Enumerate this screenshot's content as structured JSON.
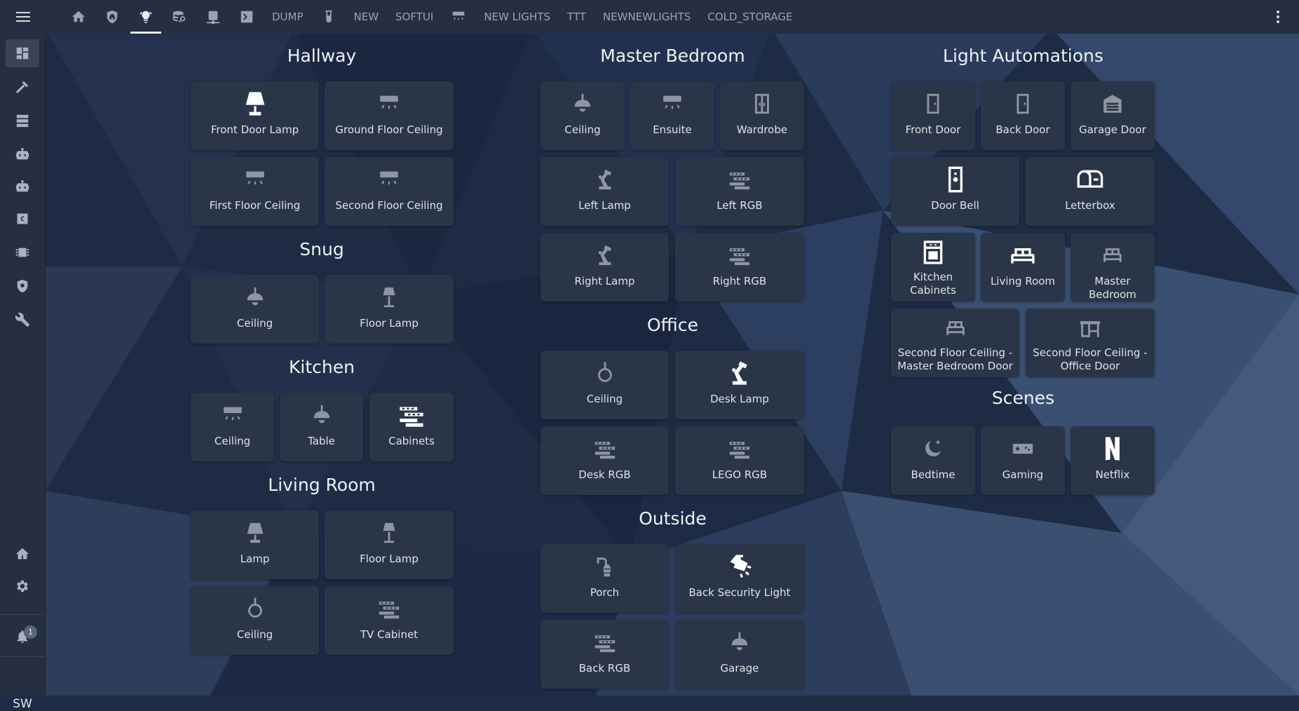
{
  "header": {
    "tabs": [
      {
        "type": "icon",
        "icon": "home-icon",
        "label": ""
      },
      {
        "type": "icon",
        "icon": "shield-home-icon",
        "label": ""
      },
      {
        "type": "icon",
        "icon": "lightbulb-group-icon",
        "label": "",
        "active": true
      },
      {
        "type": "icon",
        "icon": "database-search-icon",
        "label": ""
      },
      {
        "type": "icon",
        "icon": "network-icon",
        "label": ""
      },
      {
        "type": "icon",
        "icon": "console-icon",
        "label": ""
      },
      {
        "type": "text",
        "label": "DUMP"
      },
      {
        "type": "icon",
        "icon": "test-tube-icon",
        "label": ""
      },
      {
        "type": "text",
        "label": "NEW"
      },
      {
        "type": "text",
        "label": "SOFTUI"
      },
      {
        "type": "icon",
        "icon": "ceiling-light-icon",
        "label": ""
      },
      {
        "type": "text",
        "label": "NEW LIGHTS"
      },
      {
        "type": "text",
        "label": "TTT"
      },
      {
        "type": "text",
        "label": "NEWNEWLIGHTS"
      },
      {
        "type": "text",
        "label": "COLD_STORAGE"
      }
    ]
  },
  "sidebar": {
    "user_initials": "SW",
    "notification_count": "1"
  },
  "sections": {
    "hallway": {
      "title": "Hallway",
      "cards": [
        {
          "label": "Front Door Lamp",
          "icon": "lamp-icon",
          "bright": true
        },
        {
          "label": "Ground Floor Ceiling",
          "icon": "ceiling-light-icon"
        },
        {
          "label": "First Floor Ceiling",
          "icon": "ceiling-light-icon"
        },
        {
          "label": "Second Floor Ceiling",
          "icon": "ceiling-light-icon"
        }
      ]
    },
    "snug": {
      "title": "Snug",
      "cards": [
        {
          "label": "Ceiling",
          "icon": "pendant-light-icon"
        },
        {
          "label": "Floor Lamp",
          "icon": "floor-lamp-icon"
        }
      ]
    },
    "kitchen": {
      "title": "Kitchen",
      "cards": [
        {
          "label": "Ceiling",
          "icon": "ceiling-light-icon"
        },
        {
          "label": "Table",
          "icon": "pendant-light-icon"
        },
        {
          "label": "Cabinets",
          "icon": "led-strip-icon",
          "bright": true
        }
      ]
    },
    "living_room": {
      "title": "Living Room",
      "cards": [
        {
          "label": "Lamp",
          "icon": "lamp-icon"
        },
        {
          "label": "Floor Lamp",
          "icon": "floor-lamp-icon"
        },
        {
          "label": "Ceiling",
          "icon": "ceiling-round-icon"
        },
        {
          "label": "TV Cabinet",
          "icon": "led-strip-icon"
        }
      ]
    },
    "master_bedroom": {
      "title": "Master Bedroom",
      "cards": [
        {
          "label": "Ceiling",
          "icon": "pendant-light-icon"
        },
        {
          "label": "Ensuite",
          "icon": "ceiling-light-icon"
        },
        {
          "label": "Wardrobe",
          "icon": "wardrobe-icon"
        },
        {
          "label": "Left Lamp",
          "icon": "desk-lamp-icon"
        },
        {
          "label": "Left RGB",
          "icon": "led-strip-icon"
        },
        {
          "label": "Right Lamp",
          "icon": "desk-lamp-icon"
        },
        {
          "label": "Right RGB",
          "icon": "led-strip-icon"
        }
      ]
    },
    "office": {
      "title": "Office",
      "cards": [
        {
          "label": "Ceiling",
          "icon": "ceiling-round-icon"
        },
        {
          "label": "Desk Lamp",
          "icon": "desk-lamp-icon",
          "bright": true
        },
        {
          "label": "Desk RGB",
          "icon": "led-strip-icon"
        },
        {
          "label": "LEGO RGB",
          "icon": "led-strip-icon"
        }
      ]
    },
    "outside": {
      "title": "Outside",
      "cards": [
        {
          "label": "Porch",
          "icon": "outdoor-lamp-icon"
        },
        {
          "label": "Back Security Light",
          "icon": "floodlight-icon",
          "bright": true
        },
        {
          "label": "Back RGB",
          "icon": "led-strip-icon"
        },
        {
          "label": "Garage",
          "icon": "pendant-light-icon"
        }
      ]
    },
    "light_automations": {
      "title": "Light Automations",
      "cards": [
        {
          "label": "Front Door",
          "icon": "door-icon"
        },
        {
          "label": "Back Door",
          "icon": "door-icon"
        },
        {
          "label": "Garage Door",
          "icon": "garage-icon"
        },
        {
          "label": "Door Bell",
          "icon": "doorbell-icon",
          "bright": true
        },
        {
          "label": "Letterbox",
          "icon": "mailbox-icon",
          "bright": true
        },
        {
          "label": "Kitchen Cabinets",
          "icon": "stove-icon",
          "bright": true
        },
        {
          "label": "Living Room",
          "icon": "sofa-icon",
          "bright": true
        },
        {
          "label": "Master Bedroom",
          "icon": "bed-icon"
        },
        {
          "label": "Second Floor Ceiling - Master Bedroom Door",
          "icon": "bed-icon"
        },
        {
          "label": "Second Floor Ceiling - Office Door",
          "icon": "desk-icon"
        }
      ]
    },
    "scenes": {
      "title": "Scenes",
      "cards": [
        {
          "label": "Bedtime",
          "icon": "moon-icon"
        },
        {
          "label": "Gaming",
          "icon": "gamepad-icon"
        },
        {
          "label": "Netflix",
          "icon": "netflix-icon",
          "bright": true
        }
      ]
    }
  },
  "colors": {
    "background": "#1e2b45",
    "topbar": "#252f41",
    "card": "#2b3548",
    "icon_dim": "#8e96a3",
    "icon_bright": "#ffffff",
    "text": "#dfe3e8"
  }
}
